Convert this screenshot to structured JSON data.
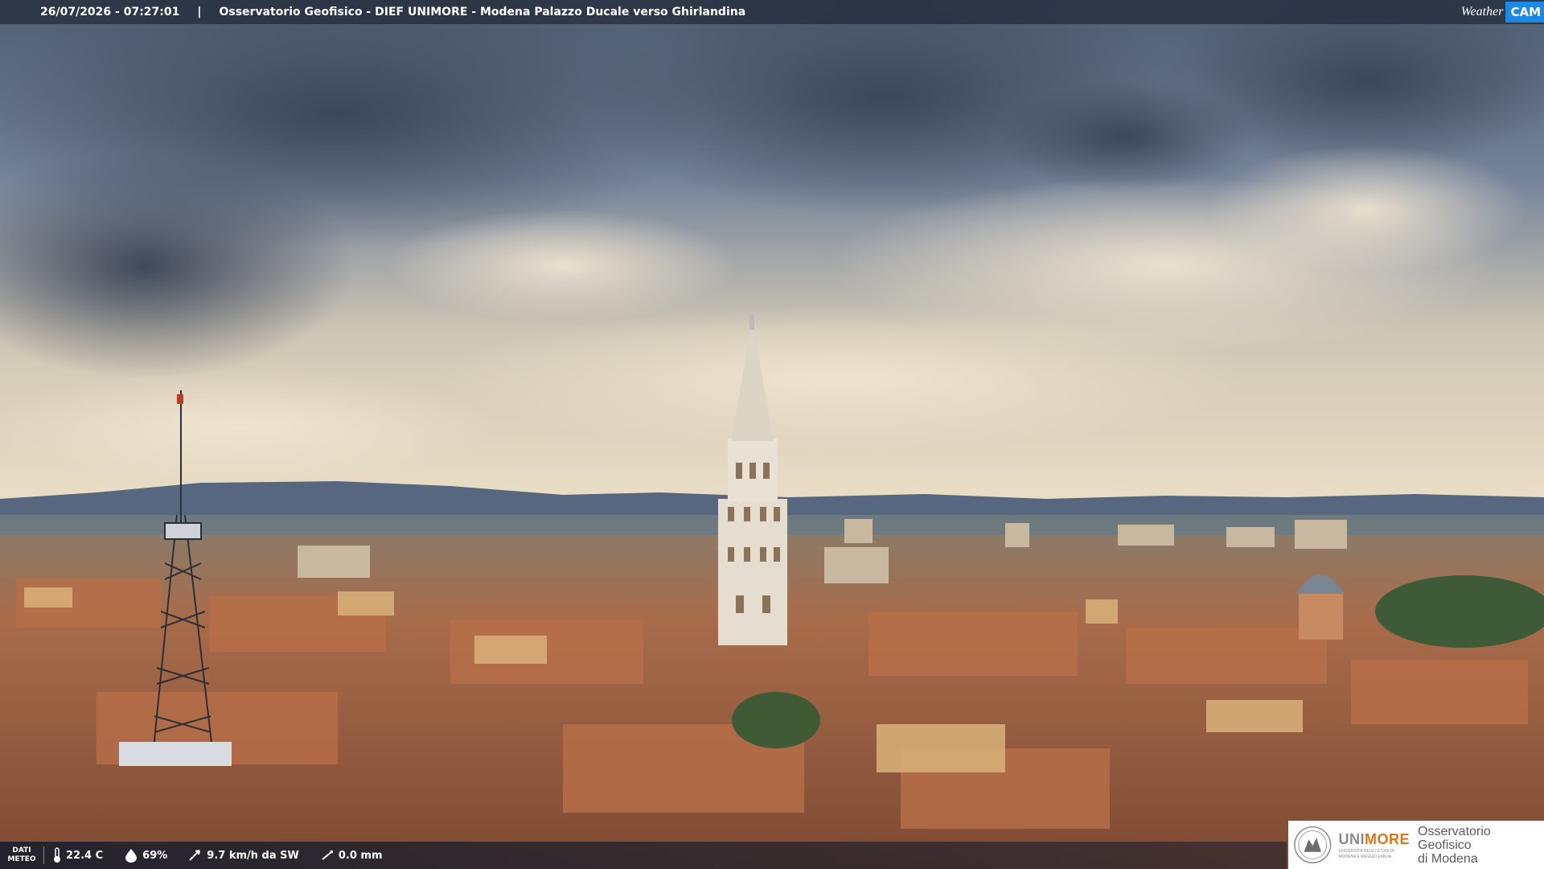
{
  "overlay": {
    "timestamp": "26/07/2026 - 07:27:01",
    "separator": "|",
    "title": "Osservatorio Geofisico - DIEF UNIMORE - Modena Palazzo Ducale verso Ghirlandina",
    "brand_word": "Weather",
    "brand_cam": "CAM"
  },
  "weather_strip": {
    "label_line1": "DATI",
    "label_line2": "METEO",
    "temperature": "22.4 C",
    "humidity": "69%",
    "wind": "9.7 km/h da SW",
    "rain": "0.0 mm",
    "icons": [
      "thermometer-icon",
      "humidity-drop-icon",
      "wind-icon",
      "rain-gauge-icon"
    ]
  },
  "logo": {
    "uni_part1": "UNI",
    "uni_part2": "MORE",
    "uni_subtitle_line1": "UNIVERSITÀ DEGLI STUDI DI",
    "uni_subtitle_line2": "MODENA E REGGIO EMILIA",
    "observatory_line1": "Osservatorio Geofisico",
    "observatory_line2": "di Modena"
  },
  "colors": {
    "sky_top": "#3c4a5e",
    "sky_bottom": "#e8dcc4",
    "roof": "#a8613f",
    "unimore_orange": "#d7781d",
    "brand_blue": "#1e88e5"
  }
}
